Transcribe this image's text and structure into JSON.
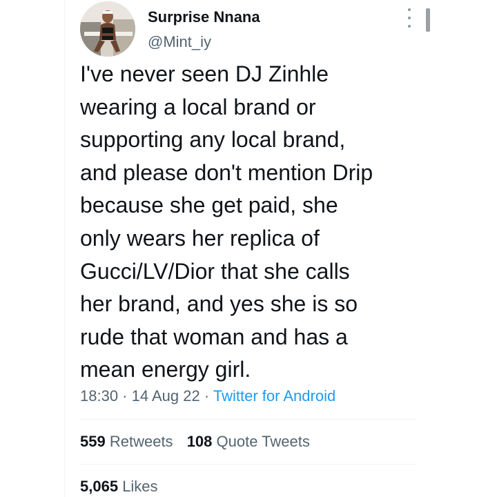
{
  "author": {
    "name": "Surprise Nnana",
    "handle": "@Mint_iy",
    "avatar_icon": "profile-photo"
  },
  "tweet": {
    "text": "I've never seen DJ Zinhle\nwearing a local brand or\nsupporting any local brand,\nand please don't mention Drip\nbecause she get paid, she\nonly wears her replica of\nGucci/LV/Dior that she calls\nher brand, and yes she is so\nrude that woman and has a\nmean energy girl."
  },
  "meta": {
    "time": "18:30",
    "separator": " · ",
    "date": "14 Aug 22",
    "source": "Twitter for Android"
  },
  "stats": {
    "retweets_count": "559",
    "retweets_label": "Retweets",
    "quotes_count": "108",
    "quotes_label": "Quote Tweets",
    "likes_count": "5,065",
    "likes_label": "Likes"
  },
  "colors": {
    "text_primary": "#0f1419",
    "text_secondary": "#536471",
    "link": "#1d9bf0",
    "divider": "#eff3f4"
  }
}
